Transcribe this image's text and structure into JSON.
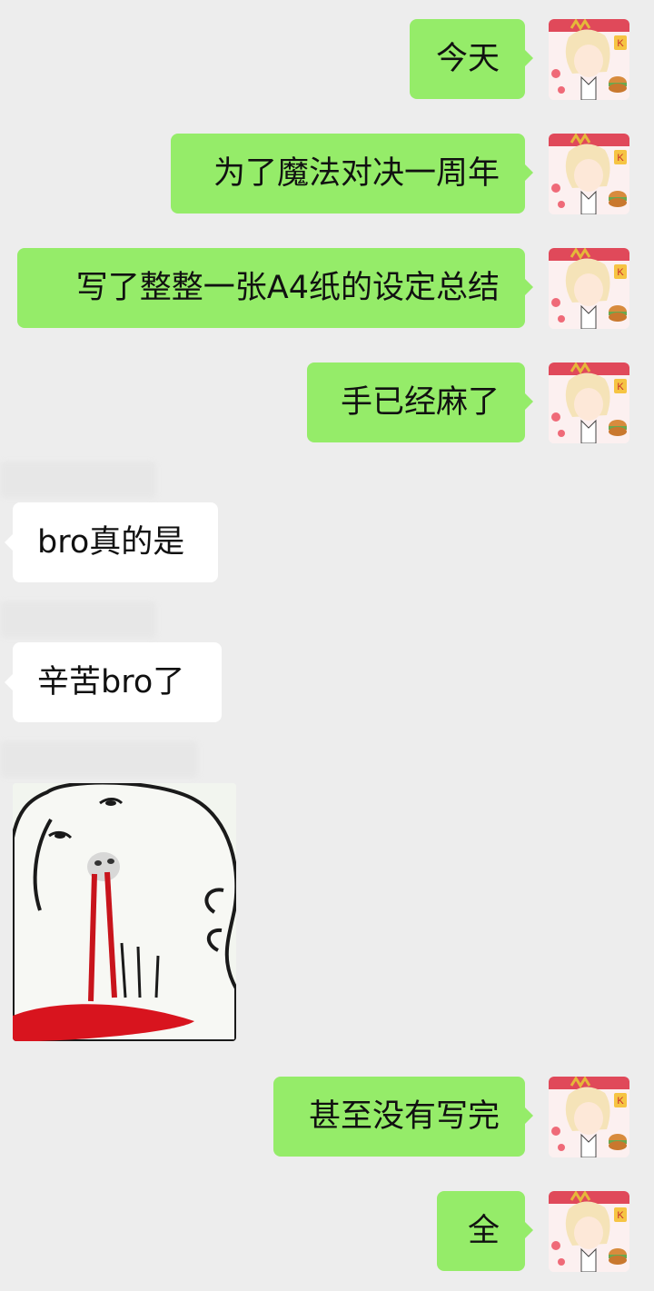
{
  "messages": [
    {
      "side": "out",
      "text": "今天"
    },
    {
      "side": "out",
      "text": "为了魔法对决一周年"
    },
    {
      "side": "out",
      "text": "写了整整一张A4纸的设定总结"
    },
    {
      "side": "out",
      "text": "手已经麻了"
    },
    {
      "side": "in",
      "text": "bro真的是"
    },
    {
      "side": "in",
      "text": "辛苦bro了"
    },
    {
      "side": "in",
      "type": "sticker",
      "icon": "nosebleed-meme-sticker"
    },
    {
      "side": "out",
      "text": "甚至没有写完"
    },
    {
      "side": "out",
      "text": "全"
    }
  ],
  "colors": {
    "background": "#ededed",
    "outgoing_bubble": "#95ec69",
    "incoming_bubble": "#ffffff"
  },
  "avatar_icon": "anime-character-avatar-icon"
}
